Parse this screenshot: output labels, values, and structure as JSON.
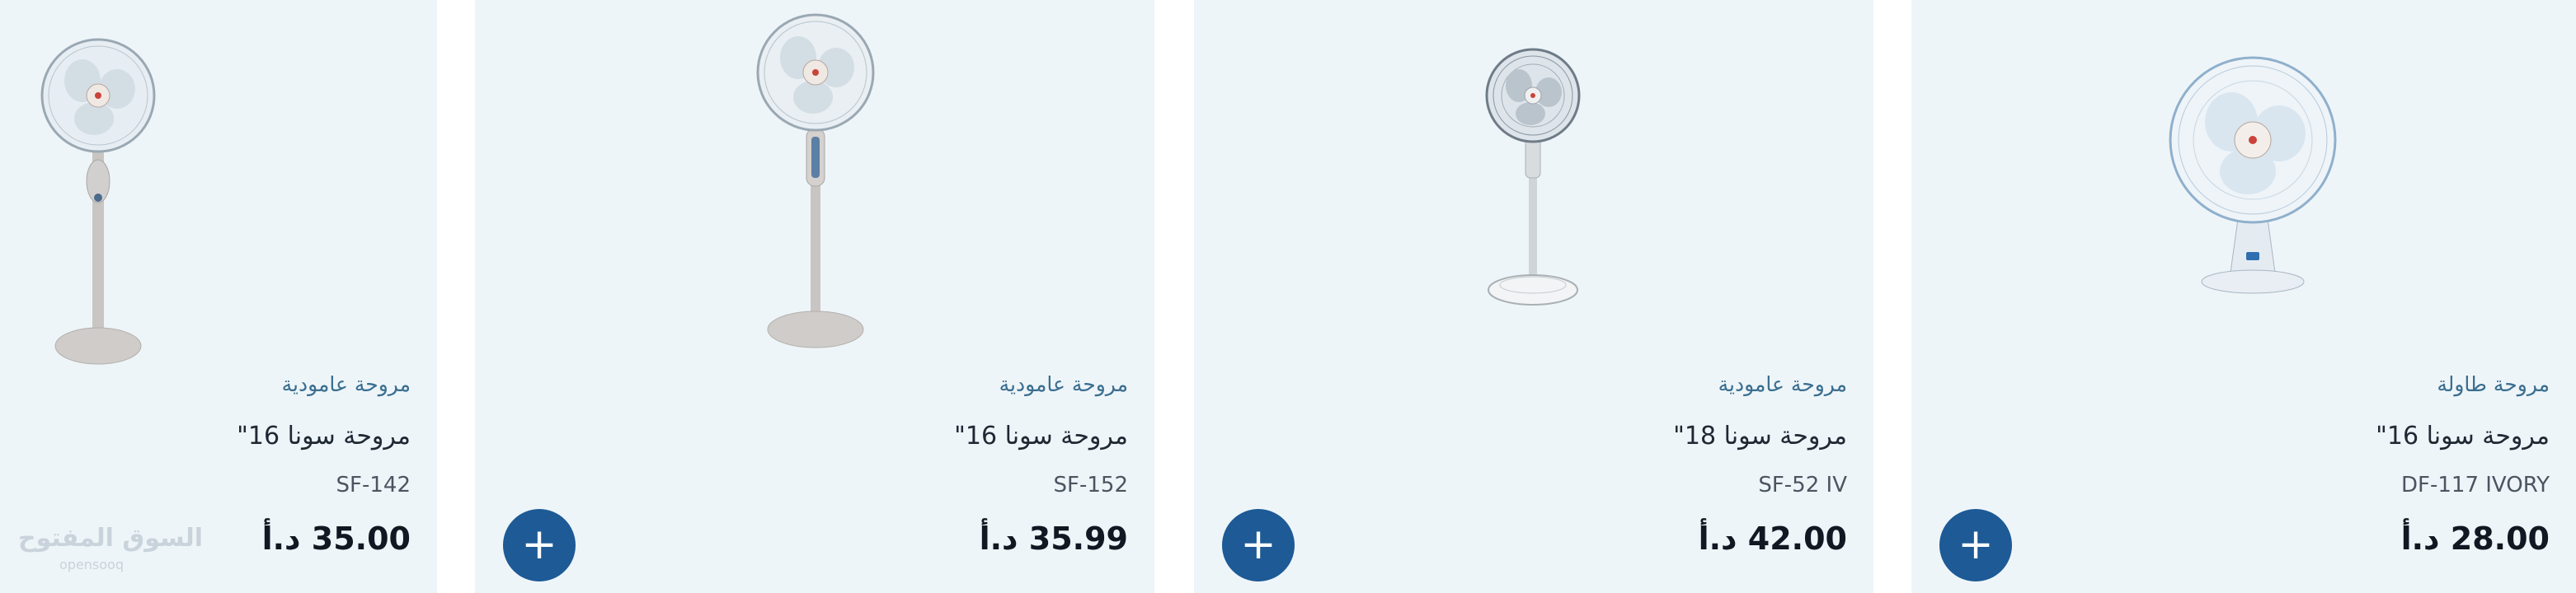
{
  "products": [
    {
      "category": "مروحة عامودية",
      "name": "مروحة سونا 16\"",
      "model": "SF-142",
      "price": "35.00 د.أ",
      "image_icon": "standing-fan-icon"
    },
    {
      "category": "مروحة عامودية",
      "name": "مروحة سونا 16\"",
      "model": "SF-152",
      "price": "35.99 د.أ",
      "add_label": "+",
      "image_icon": "standing-fan-icon"
    },
    {
      "category": "مروحة عامودية",
      "name": "مروحة سونا 18\"",
      "model": "SF-52 IV",
      "price": "42.00 د.أ",
      "add_label": "+",
      "image_icon": "standing-fan-icon"
    },
    {
      "category": "مروحة طاولة",
      "name": "مروحة سونا 16\"",
      "model": "DF-117 IVORY",
      "price": "28.00 د.أ",
      "add_label": "+",
      "image_icon": "table-fan-icon"
    }
  ],
  "watermark": {
    "text": "السوق المفتوح",
    "subtext": "opensooq"
  },
  "colors": {
    "card_bg": "#eef5f9",
    "accent": "#1d5a96",
    "category": "#3a6e8f"
  }
}
